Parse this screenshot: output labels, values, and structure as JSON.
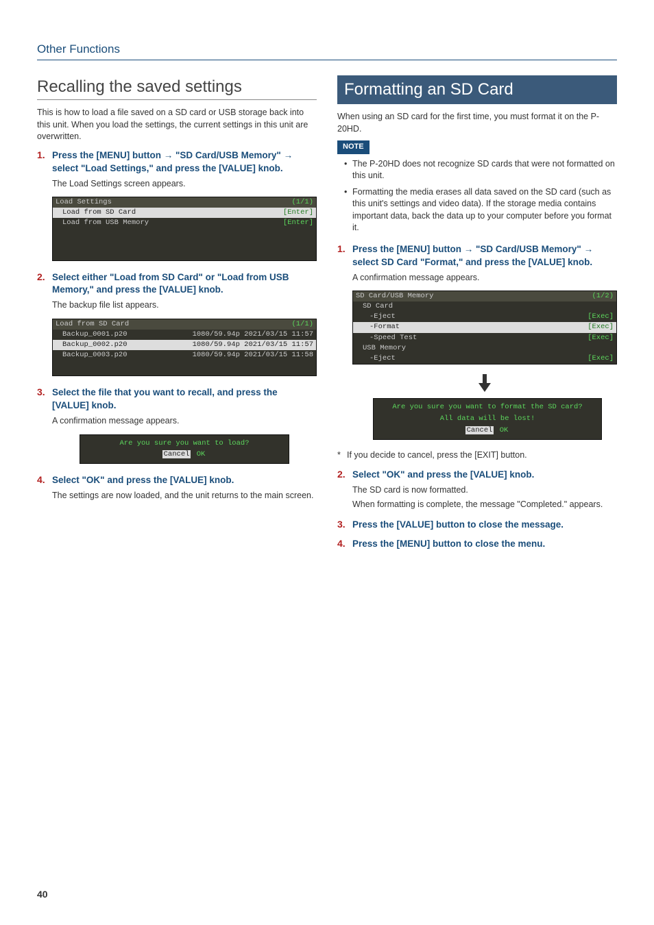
{
  "section": "Other Functions",
  "pageNum": "40",
  "left": {
    "heading": "Recalling the saved settings",
    "intro": "This is how to load a file saved on a SD card or USB storage back into this unit. When you load the settings, the current settings in this unit are overwritten.",
    "step1": {
      "num": "1.",
      "text": "Press the [MENU] button → \"SD Card/USB Memory\" → select \"Load Settings,\" and press the [VALUE] knob.",
      "body": "The Load Settings screen appears."
    },
    "screen1": {
      "title": "Load Settings",
      "page": "(1/1)",
      "rows": [
        {
          "label": "Load from SD Card",
          "action": "[Enter]",
          "sel": true
        },
        {
          "label": "Load from USB Memory",
          "action": "[Enter]",
          "sel": false
        }
      ]
    },
    "step2": {
      "num": "2.",
      "text": "Select either \"Load from SD Card\" or \"Load from USB Memory,\" and press the [VALUE] knob.",
      "body": "The backup file list appears."
    },
    "screen2": {
      "title": "Load from SD Card",
      "page": "(1/1)",
      "rows": [
        {
          "name": "Backup_0001.p20",
          "meta": "1080/59.94p  2021/03/15 11:57",
          "sel": false
        },
        {
          "name": "Backup_0002.p20",
          "meta": "1080/59.94p  2021/03/15 11:57",
          "sel": true
        },
        {
          "name": "Backup_0003.p20",
          "meta": "1080/59.94p  2021/03/15 11:58",
          "sel": false
        }
      ]
    },
    "step3": {
      "num": "3.",
      "text": "Select the file that you want to recall, and press the [VALUE] knob.",
      "body": "A confirmation message appears."
    },
    "dialog1": {
      "msg": "Are you sure you want to load?",
      "cancel": "Cancel",
      "ok": "OK"
    },
    "step4": {
      "num": "4.",
      "text": "Select \"OK\" and press the [VALUE] knob.",
      "body": "The settings are now loaded, and the unit returns to the main screen."
    }
  },
  "right": {
    "heading": "Formatting an SD Card",
    "intro": "When using an SD card for the first time, you must format it on the P-20HD.",
    "noteLabel": "NOTE",
    "notes": [
      "The P-20HD does not recognize SD cards that were not formatted on this unit.",
      "Formatting the media erases all data saved on the SD card (such as this unit's settings and video data). If the storage media contains important data, back the data up to your computer before you format it."
    ],
    "step1": {
      "num": "1.",
      "text": "Press the [MENU] button → \"SD Card/USB Memory\" → select SD Card \"Format,\" and press the [VALUE] knob.",
      "body": "A confirmation message appears."
    },
    "screen1": {
      "title": "SD Card/USB Memory",
      "page": "(1/2)",
      "groups": [
        {
          "label": "SD Card",
          "rows": [
            {
              "label": "-Eject",
              "action": "[Exec]",
              "sel": false
            },
            {
              "label": "-Format",
              "action": "[Exec]",
              "sel": true
            },
            {
              "label": "-Speed Test",
              "action": "[Exec]",
              "sel": false
            }
          ]
        },
        {
          "label": "USB Memory",
          "rows": [
            {
              "label": "-Eject",
              "action": "[Exec]",
              "sel": false
            }
          ]
        }
      ]
    },
    "dialog1": {
      "msg1": "Are you sure you want to format the SD card?",
      "msg2": "All data will be lost!",
      "cancel": "Cancel",
      "ok": "OK"
    },
    "footnote": {
      "mark": "*",
      "text": "If you decide to cancel, press the [EXIT] button."
    },
    "step2": {
      "num": "2.",
      "text": "Select \"OK\" and press the [VALUE] knob.",
      "body1": "The SD card is now formatted.",
      "body2": "When formatting is complete, the message \"Completed.\" appears."
    },
    "step3": {
      "num": "3.",
      "text": "Press the [VALUE] button to close the message."
    },
    "step4": {
      "num": "4.",
      "text": "Press the [MENU] button to close the menu."
    }
  }
}
